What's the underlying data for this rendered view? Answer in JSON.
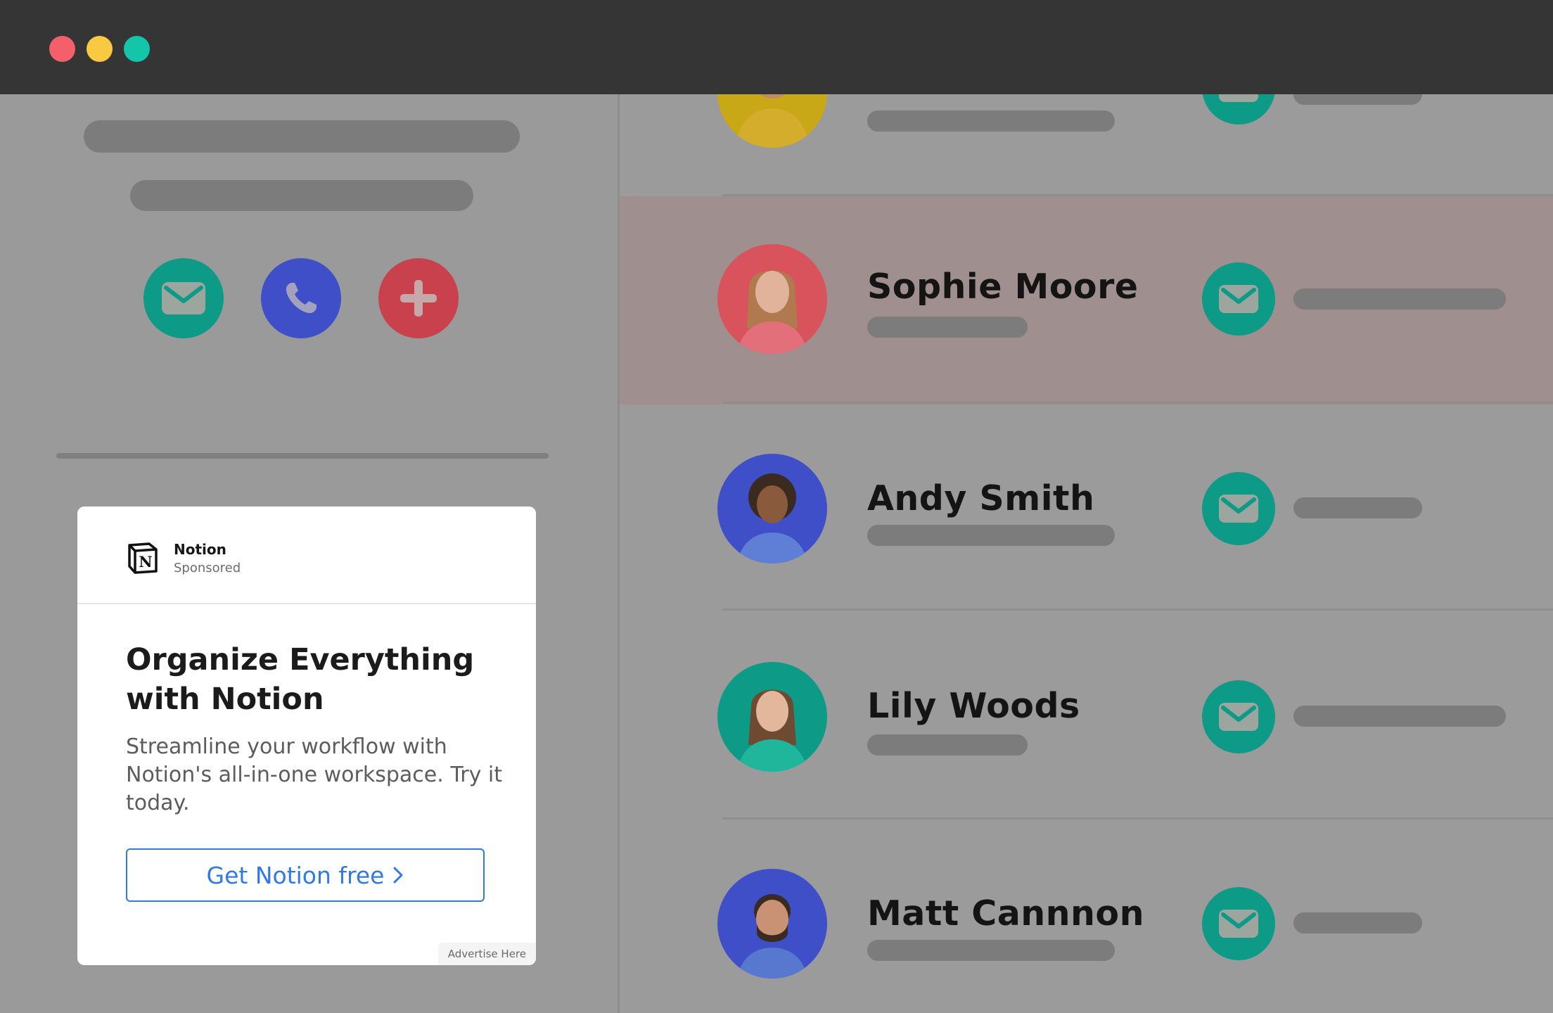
{
  "window": {
    "controls": [
      "close",
      "minimize",
      "maximize"
    ],
    "colors": {
      "close": "#f55f6b",
      "minimize": "#f9c941",
      "maximize": "#13c6a9"
    }
  },
  "profile_actions": [
    {
      "icon": "mail-icon",
      "color": "#0d9a86"
    },
    {
      "icon": "phone-icon",
      "color": "#3e4fc8"
    },
    {
      "icon": "plus-icon",
      "color": "#c9414c"
    }
  ],
  "contacts": [
    {
      "name": "",
      "avatar_color": "#c9a817",
      "highlighted": false
    },
    {
      "name": "Sophie Moore",
      "avatar_color": "#d9535c",
      "highlighted": true
    },
    {
      "name": "Andy Smith",
      "avatar_color": "#3e4fc8",
      "highlighted": false
    },
    {
      "name": "Lily Woods",
      "avatar_color": "#0d9a86",
      "highlighted": false
    },
    {
      "name": "Matt Cannnon",
      "avatar_color": "#3e4fc8",
      "highlighted": false
    }
  ],
  "ad": {
    "brand": "Notion",
    "sponsored": "Sponsored",
    "logo_icon": "notion-logo-icon",
    "title": "Organize Everything with Notion",
    "description": "Streamline your workflow with Notion's all-in-one workspace. Try it today.",
    "cta": "Get Notion free",
    "footer": "Advertise Here",
    "accent": "#2f7ae6"
  }
}
